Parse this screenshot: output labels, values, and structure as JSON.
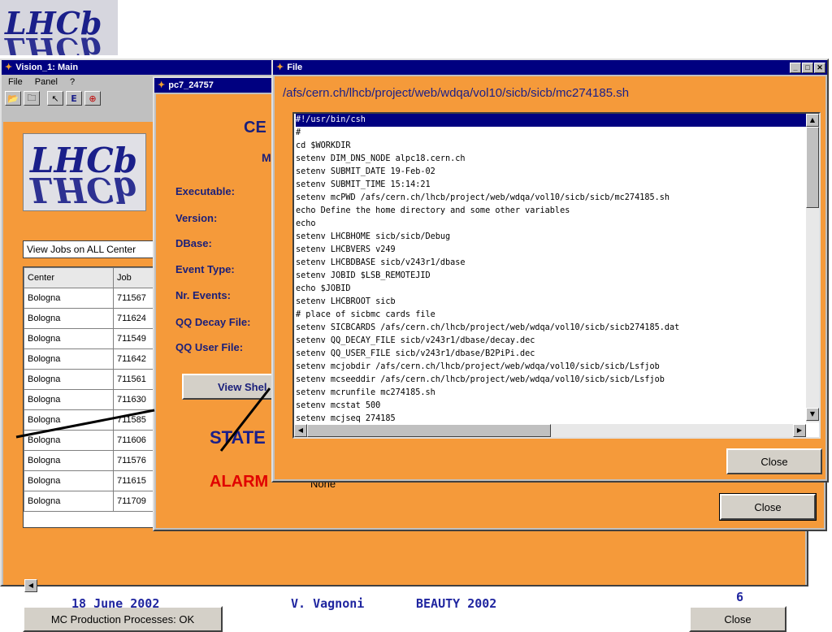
{
  "logo_text": "LHCb",
  "main_window": {
    "title": "Vision_1: Main",
    "menu": [
      "File",
      "Panel",
      "?"
    ],
    "combo_value": "View Jobs on ALL Center",
    "table": {
      "headers": [
        "Center",
        "Job"
      ],
      "rows": [
        [
          "Bologna",
          "711567"
        ],
        [
          "Bologna",
          "711624"
        ],
        [
          "Bologna",
          "711549"
        ],
        [
          "Bologna",
          "711642"
        ],
        [
          "Bologna",
          "711561"
        ],
        [
          "Bologna",
          "711630"
        ],
        [
          "Bologna",
          "711585"
        ],
        [
          "Bologna",
          "711606"
        ],
        [
          "Bologna",
          "711576"
        ],
        [
          "Bologna",
          "711615"
        ],
        [
          "Bologna",
          "711709"
        ]
      ]
    },
    "status_button": "MC Production Processes: OK",
    "close_button": "Close"
  },
  "job_window": {
    "title": "pc7_24757",
    "heading": "CE",
    "subheading": "M",
    "labels": [
      "Executable:",
      "Version:",
      "DBase:",
      "Event Type:",
      "Nr. Events:",
      "QQ Decay File:",
      "QQ User File:"
    ],
    "view_button": "View Shel",
    "state_label": "STATE",
    "alarms_label": "ALARM",
    "alarms_value": "None",
    "close_button": "Close"
  },
  "file_window": {
    "title": "File",
    "path": "/afs/cern.ch/lhcb/project/web/wdqa/vol10/sicb/sicb/mc274185.sh",
    "lines": [
      "#!/usr/bin/csh",
      "#",
      "cd $WORKDIR",
      "setenv DIM_DNS_NODE alpc18.cern.ch",
      "setenv SUBMIT_DATE 19-Feb-02",
      "setenv SUBMIT_TIME 15:14:21",
      "setenv mcPWD /afs/cern.ch/lhcb/project/web/wdqa/vol10/sicb/sicb/mc274185.sh",
      "echo Define the home directory and some other variables",
      "echo",
      "setenv LHCBHOME sicb/sicb/Debug",
      "setenv LHCBVERS v249",
      "setenv LHCBDBASE sicb/v243r1/dbase",
      "setenv JOBID $LSB_REMOTEJID",
      "echo $JOBID",
      "setenv LHCBROOT sicb",
      "# place of sicbmc cards file",
      "setenv SICBCARDS /afs/cern.ch/lhcb/project/web/wdqa/vol10/sicb/sicb274185.dat",
      "setenv QQ_DECAY_FILE sicb/v243r1/dbase/decay.dec",
      "setenv QQ_USER_FILE sicb/v243r1/dbase/B2PiPi.dec",
      "setenv mcjobdir /afs/cern.ch/lhcb/project/web/wdqa/vol10/sicb/sicb/Lsfjob",
      "setenv mcseeddir /afs/cern.ch/lhcb/project/web/wdqa/vol10/sicb/sicb/Lsfjob",
      "setenv mcrunfile mc274185.sh",
      "setenv mcstat 500",
      "setenv mcjseq 274185"
    ],
    "close_button": "Close"
  },
  "footer": {
    "date": "18 June 2002",
    "author": "V. Vagnoni",
    "event": "BEAUTY 2002",
    "page": "6"
  }
}
